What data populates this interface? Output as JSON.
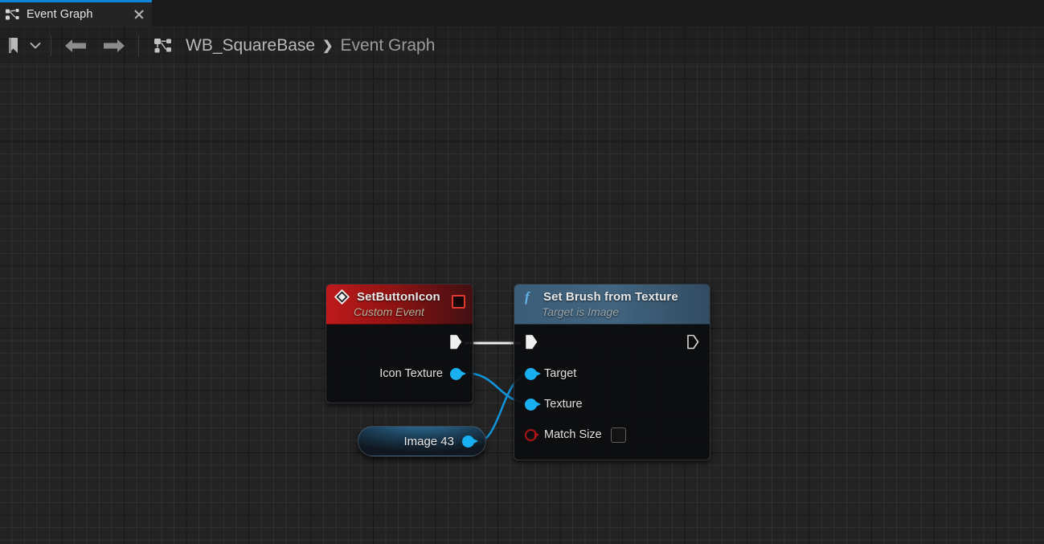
{
  "window": {
    "accent_color": "#0b84d8",
    "canvas_bg": "#232323"
  },
  "tab": {
    "label": "Event Graph",
    "icon": "graph-icon",
    "close_icon": "close-icon"
  },
  "toolbar": {
    "bookmark_icon": "bookmark-icon",
    "dropdown_icon": "chevron-down-icon",
    "back_icon": "arrow-left-icon",
    "forward_icon": "arrow-right-icon",
    "graph_icon": "graph-icon",
    "breadcrumb": {
      "owner": "WB_SquareBase",
      "separator": "❯",
      "current": "Event Graph"
    }
  },
  "graph": {
    "nodes": [
      {
        "id": "set-button-icon",
        "type": "custom-event",
        "title": "SetButtonIcon",
        "subtitle": "Custom Event",
        "header_color": "#be1a1a",
        "icon": "event-diamond-icon",
        "delegate_pin": "delegate-pin",
        "outputs": [
          {
            "name": "exec",
            "label": "",
            "kind": "exec",
            "connected": true
          },
          {
            "name": "icon-texture",
            "label": "Icon Texture",
            "kind": "object",
            "color": "#18b0f0",
            "connected": true
          }
        ]
      },
      {
        "id": "set-brush-from-texture",
        "type": "function",
        "title": "Set Brush from Texture",
        "subtitle": "Target is Image",
        "header_color": "#466a86",
        "icon": "function-f-icon",
        "inputs": [
          {
            "name": "exec-in",
            "label": "",
            "kind": "exec",
            "connected": true
          },
          {
            "name": "target",
            "label": "Target",
            "kind": "object",
            "color": "#18b0f0",
            "connected": true
          },
          {
            "name": "texture",
            "label": "Texture",
            "kind": "object",
            "color": "#18b0f0",
            "connected": true
          },
          {
            "name": "match-size",
            "label": "Match Size",
            "kind": "bool",
            "color": "#b01414",
            "connected": false,
            "checkbox_checked": false
          }
        ],
        "outputs": [
          {
            "name": "exec-out",
            "label": "",
            "kind": "exec",
            "connected": false
          }
        ]
      },
      {
        "id": "image-43",
        "type": "variable-get",
        "title": "Image 43",
        "outputs": [
          {
            "name": "image-43-out",
            "label": "",
            "kind": "object",
            "color": "#18b0f0",
            "connected": true
          }
        ]
      }
    ],
    "wires": [
      {
        "from": "set-button-icon.exec",
        "to": "set-brush-from-texture.exec-in",
        "color": "#ffffff",
        "kind": "exec"
      },
      {
        "from": "set-button-icon.icon-texture",
        "to": "set-brush-from-texture.texture",
        "color": "#1292d6",
        "kind": "data"
      },
      {
        "from": "image-43.image-43-out",
        "to": "set-brush-from-texture.target",
        "color": "#1292d6",
        "kind": "data"
      }
    ]
  }
}
